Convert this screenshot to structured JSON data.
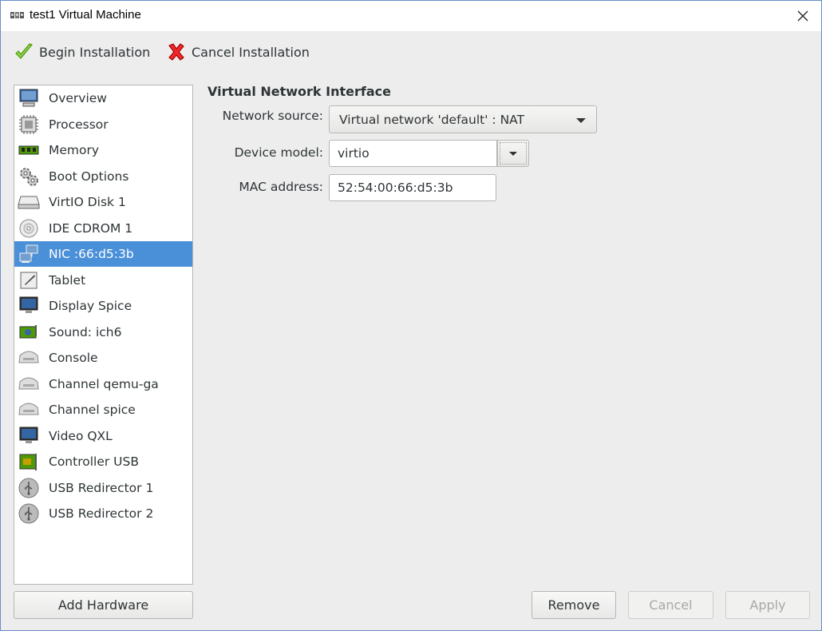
{
  "window": {
    "title": "test1 Virtual Machine"
  },
  "toolbar": {
    "begin_label": "Begin Installation",
    "cancel_label": "Cancel Installation"
  },
  "sidebar": {
    "items": [
      {
        "label": "Overview",
        "icon": "computer-icon"
      },
      {
        "label": "Processor",
        "icon": "cpu-icon"
      },
      {
        "label": "Memory",
        "icon": "memory-icon"
      },
      {
        "label": "Boot Options",
        "icon": "gears-icon"
      },
      {
        "label": "VirtIO Disk 1",
        "icon": "disk-icon"
      },
      {
        "label": "IDE CDROM 1",
        "icon": "cdrom-icon"
      },
      {
        "label": "NIC :66:d5:3b",
        "icon": "network-icon",
        "selected": true
      },
      {
        "label": "Tablet",
        "icon": "tablet-icon"
      },
      {
        "label": "Display Spice",
        "icon": "monitor-icon"
      },
      {
        "label": "Sound: ich6",
        "icon": "sound-card-icon"
      },
      {
        "label": "Console",
        "icon": "serial-icon"
      },
      {
        "label": "Channel qemu-ga",
        "icon": "serial-icon"
      },
      {
        "label": "Channel spice",
        "icon": "serial-icon"
      },
      {
        "label": "Video QXL",
        "icon": "monitor-icon"
      },
      {
        "label": "Controller USB",
        "icon": "controller-card-icon"
      },
      {
        "label": "USB Redirector 1",
        "icon": "usb-icon"
      },
      {
        "label": "USB Redirector 2",
        "icon": "usb-icon"
      }
    ],
    "add_hardware_label": "Add Hardware"
  },
  "panel": {
    "title": "Virtual Network Interface",
    "network_source_label": "Network source:",
    "network_source_value": "Virtual network 'default' : NAT",
    "device_model_label": "Device model:",
    "device_model_value": "virtio",
    "mac_label": "MAC address:",
    "mac_value": "52:54:00:66:d5:3b"
  },
  "footer": {
    "remove_label": "Remove",
    "cancel_label": "Cancel",
    "apply_label": "Apply"
  },
  "colors": {
    "selection": "#4a90d9",
    "window_border": "#6a8fc7"
  }
}
